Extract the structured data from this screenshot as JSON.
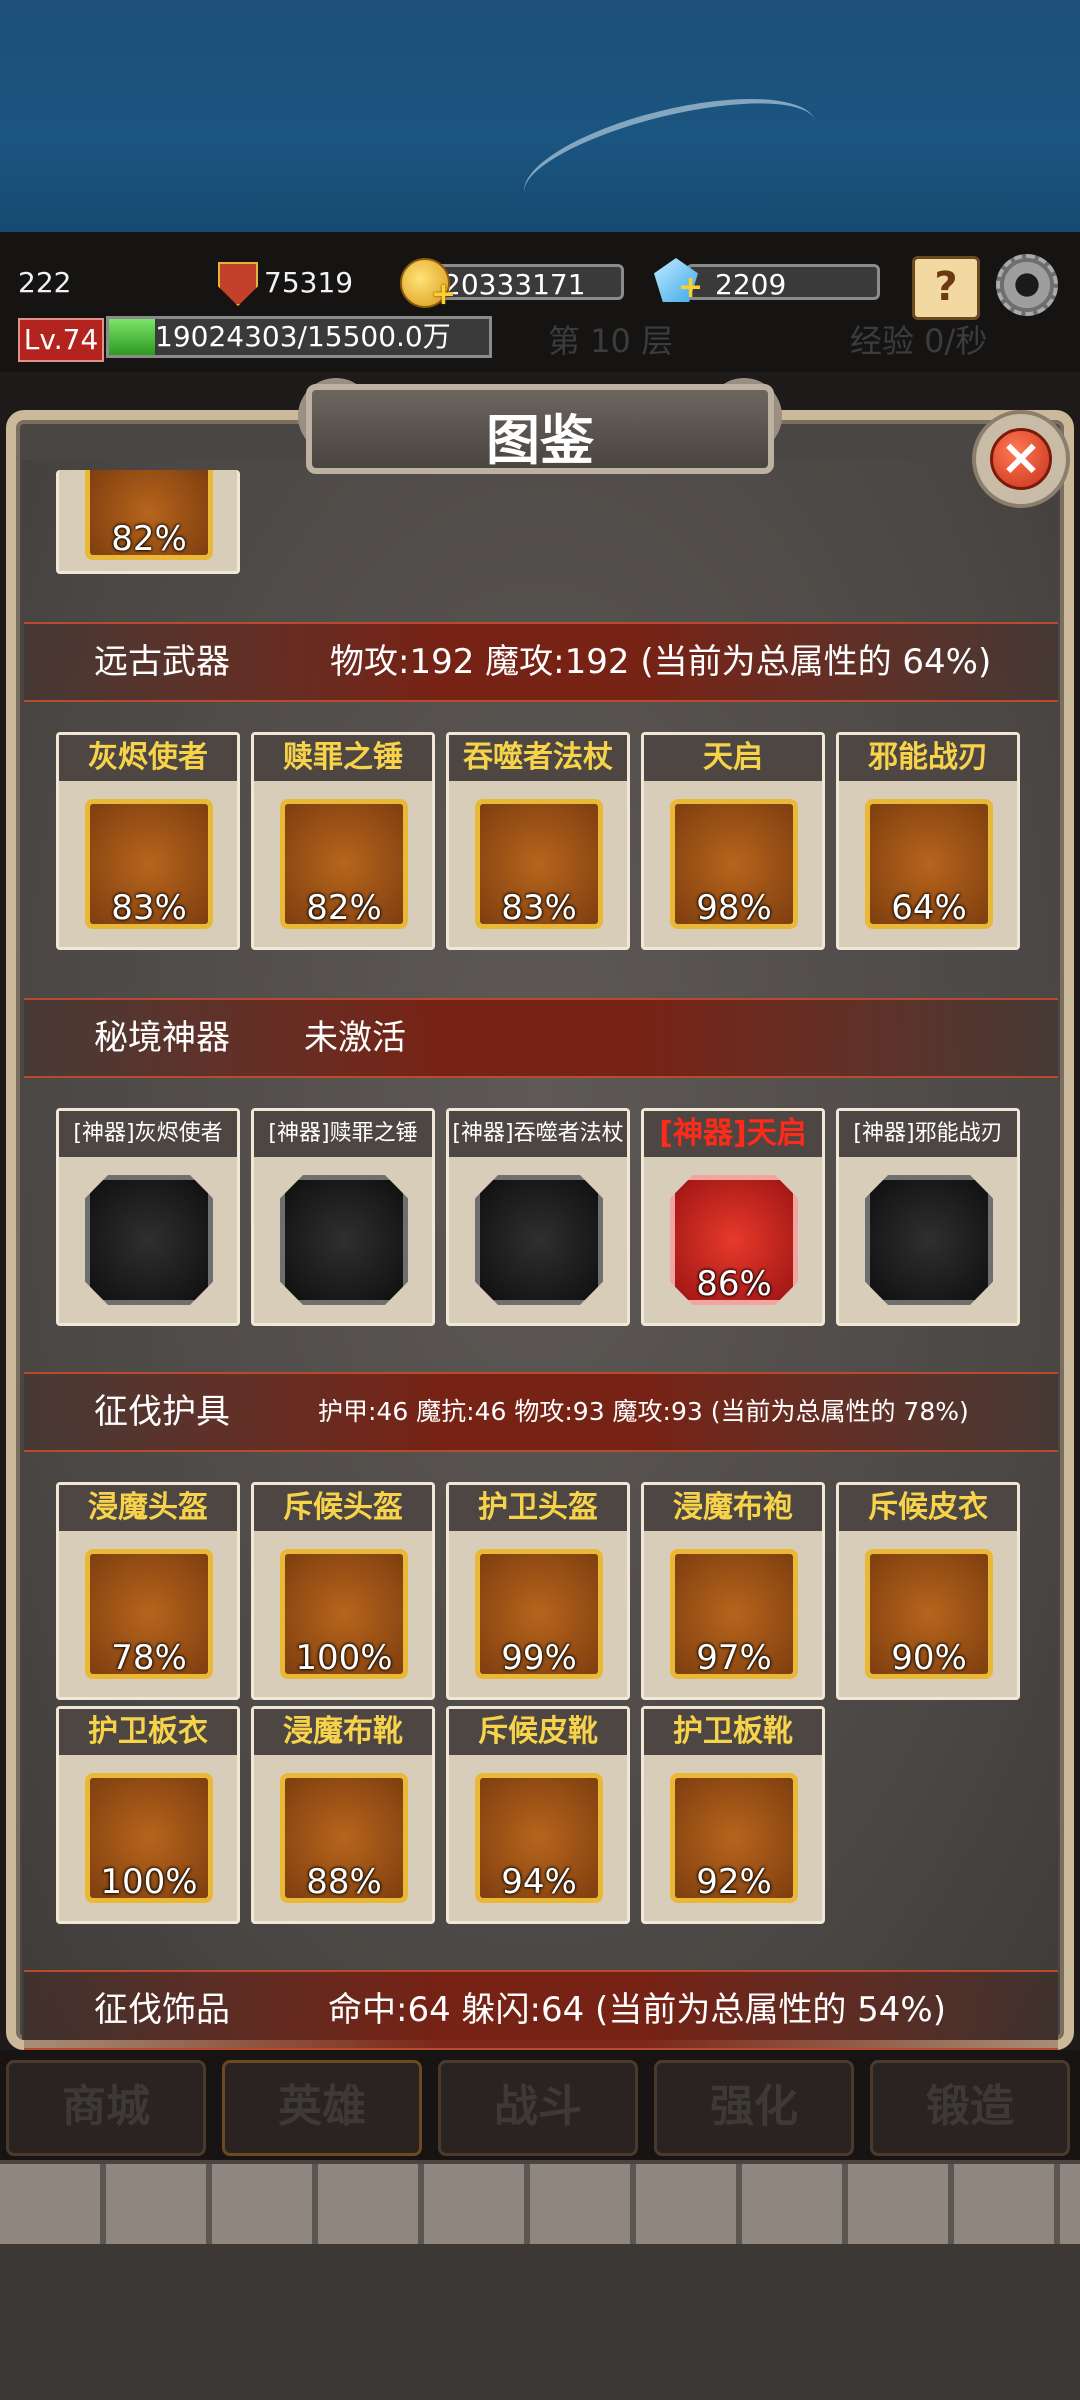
{
  "hud": {
    "left_number": "222",
    "power": "75319",
    "gold": "20333171",
    "gems": "2209",
    "level": "Lv.74",
    "xp": "19024303/15500.0万",
    "xp_fraction": 0.12,
    "floor_ghost": "第 10 层",
    "exp_ghost": "经验 0/秒"
  },
  "panel": {
    "title": "图鉴",
    "close": "×",
    "partial_pct": "82%"
  },
  "sections": {
    "ancient_weapons": {
      "name": "远古武器",
      "stats": "物攻:192  魔攻:192 (当前为总属性的 64%)",
      "items": [
        {
          "name": "灰烬使者",
          "pct": "83%"
        },
        {
          "name": "赎罪之锤",
          "pct": "82%"
        },
        {
          "name": "吞噬者法杖",
          "pct": "83%"
        },
        {
          "name": "天启",
          "pct": "98%"
        },
        {
          "name": "邪能战刃",
          "pct": "64%"
        }
      ]
    },
    "secret_artifacts": {
      "name": "秘境神器",
      "status": "未激活",
      "items": [
        {
          "name": "[神器]灰烬使者",
          "pct": ""
        },
        {
          "name": "[神器]赎罪之锤",
          "pct": ""
        },
        {
          "name": "[神器]吞噬者法杖",
          "pct": ""
        },
        {
          "name": "[神器]天启",
          "pct": "86%"
        },
        {
          "name": "[神器]邪能战刃",
          "pct": ""
        }
      ]
    },
    "conquest_armor": {
      "name": "征伐护具",
      "stats": "护甲:46  魔抗:46  物攻:93  魔攻:93 (当前为总属性的 78%)",
      "items": [
        {
          "name": "浸魔头盔",
          "pct": "78%"
        },
        {
          "name": "斥候头盔",
          "pct": "100%"
        },
        {
          "name": "护卫头盔",
          "pct": "99%"
        },
        {
          "name": "浸魔布袍",
          "pct": "97%"
        },
        {
          "name": "斥候皮衣",
          "pct": "90%"
        },
        {
          "name": "护卫板衣",
          "pct": "100%"
        },
        {
          "name": "浸魔布靴",
          "pct": "88%"
        },
        {
          "name": "斥候皮靴",
          "pct": "94%"
        },
        {
          "name": "护卫板靴",
          "pct": "92%"
        }
      ]
    },
    "conquest_accessories": {
      "name": "征伐饰品",
      "stats": "命中:64  躲闪:64 (当前为总属性的 54%)"
    }
  },
  "nav": {
    "tabs": [
      "商城",
      "英雄",
      "战斗",
      "强化",
      "锻造"
    ]
  },
  "colors": {
    "gold_label": "#f6d34a",
    "artifact_red": "#ff2a1a",
    "xp_green": "#4cc23a",
    "section_red": "#782012"
  }
}
